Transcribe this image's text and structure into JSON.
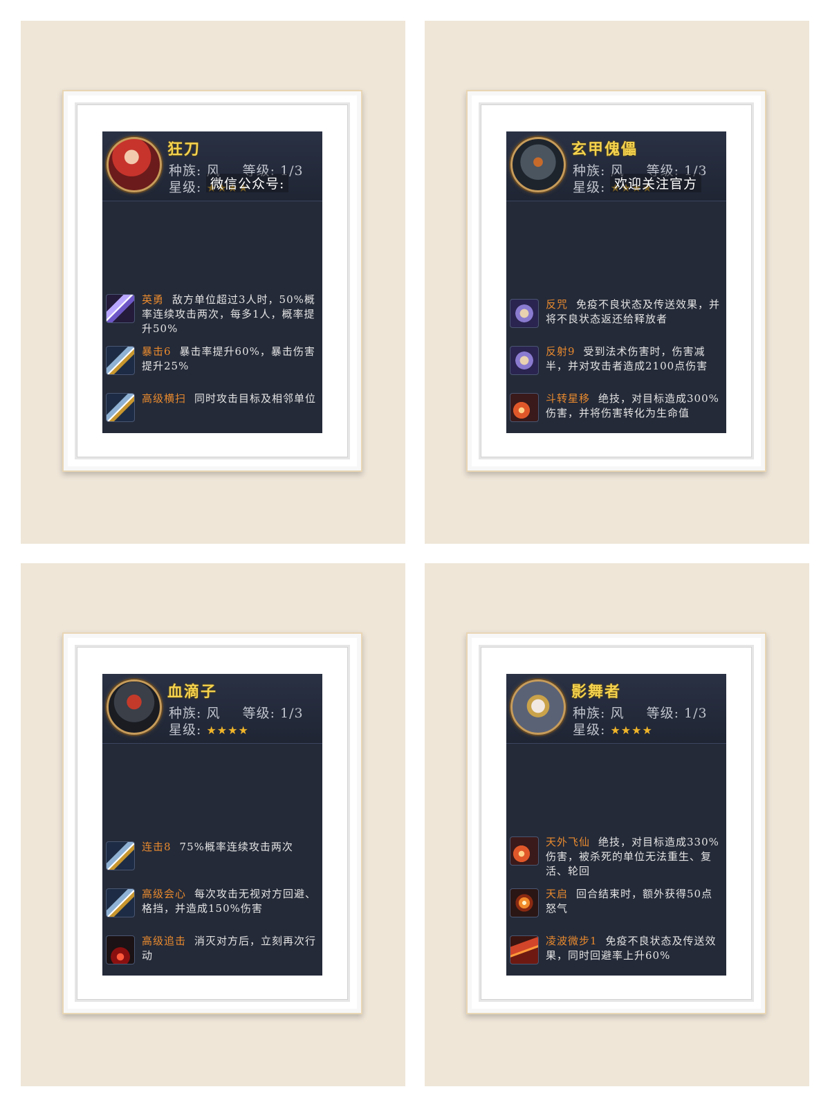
{
  "labels": {
    "race": "种族:",
    "level": "等级:",
    "star": "星级:"
  },
  "cards": [
    {
      "name": "狂刀",
      "race": "风",
      "level": "1/3",
      "stars": "★★★★",
      "watermark": "微信公众号:",
      "portrait": "red-haired-warrior-portrait",
      "skills": [
        {
          "icon": "wind-slash-icon",
          "name": "英勇",
          "desc": "敌方单位超过3人时，50%概率连续攻击两次，每多1人，概率提升50%"
        },
        {
          "icon": "blade-icon",
          "name": "暴击6",
          "desc": "暴击率提升60%，暴击伤害提升25%"
        },
        {
          "icon": "blade-icon",
          "name": "高级横扫",
          "desc": "同时攻击目标及相邻单位"
        }
      ]
    },
    {
      "name": "玄甲傀儡",
      "race": "风",
      "level": "1/3",
      "stars": "★★★★",
      "watermark": "欢迎关注官方",
      "portrait": "golem-portrait",
      "skills": [
        {
          "icon": "shield-icon",
          "name": "反咒",
          "desc": "免疫不良状态及传送效果，并将不良状态返还给释放者"
        },
        {
          "icon": "shield-icon",
          "name": "反射9",
          "desc": "受到法术伤害时，伤害减半，并对攻击者造成2100点伤害"
        },
        {
          "icon": "fire-icon",
          "name": "斗转星移",
          "desc": "绝技，对目标造成300%伤害，并将伤害转化为生命值"
        }
      ]
    },
    {
      "name": "血滴子",
      "race": "风",
      "level": "1/3",
      "stars": "★★★★",
      "portrait": "masked-assassin-portrait",
      "skills": [
        {
          "icon": "blade-icon",
          "name": "连击8",
          "desc": "75%概率连续攻击两次"
        },
        {
          "icon": "blade-icon",
          "name": "高级会心",
          "desc": "每次攻击无视对方回避、格挡，并造成150%伤害"
        },
        {
          "icon": "blood-icon",
          "name": "高级追击",
          "desc": "消灭对方后，立刻再次行动"
        }
      ]
    },
    {
      "name": "影舞者",
      "race": "风",
      "level": "1/3",
      "stars": "★★★★",
      "portrait": "veiled-dancer-portrait",
      "skills": [
        {
          "icon": "fire-icon",
          "name": "天外飞仙",
          "desc": "绝技，对目标造成330%伤害，被杀死的单位无法重生、复活、轮回"
        },
        {
          "icon": "burst-icon",
          "name": "天启",
          "desc": "回合结束时，额外获得50点怒气"
        },
        {
          "icon": "armor-icon",
          "name": "凌波微步1",
          "desc": "免疫不良状态及传送效果，同时回避率上升60%"
        }
      ]
    }
  ]
}
